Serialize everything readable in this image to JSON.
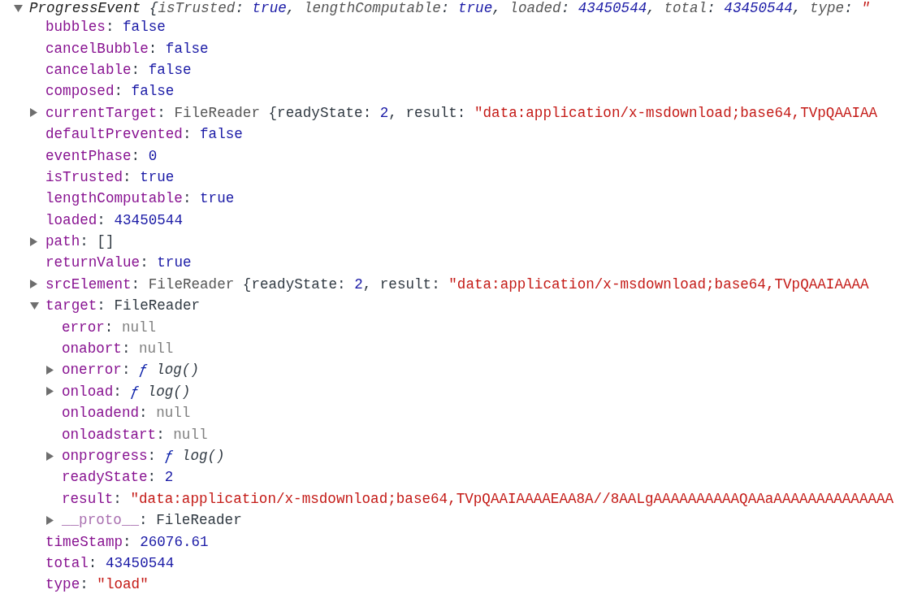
{
  "root": {
    "kind": "expandable",
    "expanded": true,
    "tokens": [
      {
        "text": "ProgressEvent",
        "kind": "class"
      },
      {
        "text": " {",
        "kind": "punct"
      },
      {
        "text": "isTrusted",
        "kind": "pkey"
      },
      {
        "text": ": ",
        "kind": "punct"
      },
      {
        "text": "true",
        "kind": "boolean"
      },
      {
        "text": ", ",
        "kind": "punct"
      },
      {
        "text": "lengthComputable",
        "kind": "pkey"
      },
      {
        "text": ": ",
        "kind": "punct"
      },
      {
        "text": "true",
        "kind": "boolean"
      },
      {
        "text": ", ",
        "kind": "punct"
      },
      {
        "text": "loaded",
        "kind": "pkey"
      },
      {
        "text": ": ",
        "kind": "punct"
      },
      {
        "text": "43450544",
        "kind": "number"
      },
      {
        "text": ", ",
        "kind": "punct"
      },
      {
        "text": "total",
        "kind": "pkey"
      },
      {
        "text": ": ",
        "kind": "punct"
      },
      {
        "text": "43450544",
        "kind": "number"
      },
      {
        "text": ", ",
        "kind": "punct"
      },
      {
        "text": "type",
        "kind": "pkey"
      },
      {
        "text": ": ",
        "kind": "punct"
      },
      {
        "text": "\"",
        "kind": "string"
      }
    ],
    "children": [
      {
        "kind": "leaf",
        "tokens": [
          {
            "text": "bubbles",
            "kind": "key"
          },
          {
            "text": ": ",
            "kind": "punct"
          },
          {
            "text": "false",
            "kind": "boolean"
          }
        ]
      },
      {
        "kind": "leaf",
        "tokens": [
          {
            "text": "cancelBubble",
            "kind": "key"
          },
          {
            "text": ": ",
            "kind": "punct"
          },
          {
            "text": "false",
            "kind": "boolean"
          }
        ]
      },
      {
        "kind": "leaf",
        "tokens": [
          {
            "text": "cancelable",
            "kind": "key"
          },
          {
            "text": ": ",
            "kind": "punct"
          },
          {
            "text": "false",
            "kind": "boolean"
          }
        ]
      },
      {
        "kind": "leaf",
        "tokens": [
          {
            "text": "composed",
            "kind": "key"
          },
          {
            "text": ": ",
            "kind": "punct"
          },
          {
            "text": "false",
            "kind": "boolean"
          }
        ]
      },
      {
        "kind": "expandable",
        "expanded": false,
        "tokens": [
          {
            "text": "currentTarget",
            "kind": "key"
          },
          {
            "text": ": ",
            "kind": "punct"
          },
          {
            "text": "FileReader",
            "kind": "object"
          },
          {
            "text": " {readyState: ",
            "kind": "punct"
          },
          {
            "text": "2",
            "kind": "number"
          },
          {
            "text": ", result: ",
            "kind": "punct"
          },
          {
            "text": "\"data:application/x-msdownload;base64,TVpQAAIAA",
            "kind": "string"
          }
        ]
      },
      {
        "kind": "leaf",
        "tokens": [
          {
            "text": "defaultPrevented",
            "kind": "key"
          },
          {
            "text": ": ",
            "kind": "punct"
          },
          {
            "text": "false",
            "kind": "boolean"
          }
        ]
      },
      {
        "kind": "leaf",
        "tokens": [
          {
            "text": "eventPhase",
            "kind": "key"
          },
          {
            "text": ": ",
            "kind": "punct"
          },
          {
            "text": "0",
            "kind": "number"
          }
        ]
      },
      {
        "kind": "leaf",
        "tokens": [
          {
            "text": "isTrusted",
            "kind": "key"
          },
          {
            "text": ": ",
            "kind": "punct"
          },
          {
            "text": "true",
            "kind": "boolean"
          }
        ]
      },
      {
        "kind": "leaf",
        "tokens": [
          {
            "text": "lengthComputable",
            "kind": "key"
          },
          {
            "text": ": ",
            "kind": "punct"
          },
          {
            "text": "true",
            "kind": "boolean"
          }
        ]
      },
      {
        "kind": "leaf",
        "tokens": [
          {
            "text": "loaded",
            "kind": "key"
          },
          {
            "text": ": ",
            "kind": "punct"
          },
          {
            "text": "43450544",
            "kind": "number"
          }
        ]
      },
      {
        "kind": "expandable",
        "expanded": false,
        "tokens": [
          {
            "text": "path",
            "kind": "key"
          },
          {
            "text": ": ",
            "kind": "punct"
          },
          {
            "text": "[]",
            "kind": "punct"
          }
        ]
      },
      {
        "kind": "leaf",
        "tokens": [
          {
            "text": "returnValue",
            "kind": "key"
          },
          {
            "text": ": ",
            "kind": "punct"
          },
          {
            "text": "true",
            "kind": "boolean"
          }
        ]
      },
      {
        "kind": "expandable",
        "expanded": false,
        "tokens": [
          {
            "text": "srcElement",
            "kind": "key"
          },
          {
            "text": ": ",
            "kind": "punct"
          },
          {
            "text": "FileReader",
            "kind": "object"
          },
          {
            "text": " {readyState: ",
            "kind": "punct"
          },
          {
            "text": "2",
            "kind": "number"
          },
          {
            "text": ", result: ",
            "kind": "punct"
          },
          {
            "text": "\"data:application/x-msdownload;base64,TVpQAAIAAAA",
            "kind": "string"
          }
        ]
      },
      {
        "kind": "expandable",
        "expanded": true,
        "tokens": [
          {
            "text": "target",
            "kind": "key"
          },
          {
            "text": ": ",
            "kind": "punct"
          },
          {
            "text": "FileReader",
            "kind": "punct"
          }
        ],
        "children": [
          {
            "kind": "leaf",
            "tokens": [
              {
                "text": "error",
                "kind": "key"
              },
              {
                "text": ": ",
                "kind": "punct"
              },
              {
                "text": "null",
                "kind": "null"
              }
            ]
          },
          {
            "kind": "leaf",
            "tokens": [
              {
                "text": "onabort",
                "kind": "key"
              },
              {
                "text": ": ",
                "kind": "punct"
              },
              {
                "text": "null",
                "kind": "null"
              }
            ]
          },
          {
            "kind": "expandable",
            "expanded": false,
            "tokens": [
              {
                "text": "onerror",
                "kind": "key"
              },
              {
                "text": ": ",
                "kind": "punct"
              },
              {
                "text": "ƒ",
                "kind": "function"
              },
              {
                "text": " log()",
                "kind": "fname"
              }
            ]
          },
          {
            "kind": "expandable",
            "expanded": false,
            "tokens": [
              {
                "text": "onload",
                "kind": "key"
              },
              {
                "text": ": ",
                "kind": "punct"
              },
              {
                "text": "ƒ",
                "kind": "function"
              },
              {
                "text": " log()",
                "kind": "fname"
              }
            ]
          },
          {
            "kind": "leaf",
            "tokens": [
              {
                "text": "onloadend",
                "kind": "key"
              },
              {
                "text": ": ",
                "kind": "punct"
              },
              {
                "text": "null",
                "kind": "null"
              }
            ]
          },
          {
            "kind": "leaf",
            "tokens": [
              {
                "text": "onloadstart",
                "kind": "key"
              },
              {
                "text": ": ",
                "kind": "punct"
              },
              {
                "text": "null",
                "kind": "null"
              }
            ]
          },
          {
            "kind": "expandable",
            "expanded": false,
            "tokens": [
              {
                "text": "onprogress",
                "kind": "key"
              },
              {
                "text": ": ",
                "kind": "punct"
              },
              {
                "text": "ƒ",
                "kind": "function"
              },
              {
                "text": " log()",
                "kind": "fname"
              }
            ]
          },
          {
            "kind": "leaf",
            "tokens": [
              {
                "text": "readyState",
                "kind": "key"
              },
              {
                "text": ": ",
                "kind": "punct"
              },
              {
                "text": "2",
                "kind": "number"
              }
            ]
          },
          {
            "kind": "leaf",
            "tokens": [
              {
                "text": "result",
                "kind": "key"
              },
              {
                "text": ": ",
                "kind": "punct"
              },
              {
                "text": "\"data:application/x-msdownload;base64,TVpQAAIAAAAEAA8A//8AALgAAAAAAAAAAQAAaAAAAAAAAAAAAAA",
                "kind": "string"
              }
            ]
          },
          {
            "kind": "expandable",
            "expanded": false,
            "tokens": [
              {
                "text": "__proto__",
                "kind": "protokey"
              },
              {
                "text": ": ",
                "kind": "punct"
              },
              {
                "text": "FileReader",
                "kind": "punct"
              }
            ]
          }
        ]
      },
      {
        "kind": "leaf",
        "tokens": [
          {
            "text": "timeStamp",
            "kind": "key"
          },
          {
            "text": ": ",
            "kind": "punct"
          },
          {
            "text": "26076.61",
            "kind": "number"
          }
        ]
      },
      {
        "kind": "leaf",
        "tokens": [
          {
            "text": "total",
            "kind": "key"
          },
          {
            "text": ": ",
            "kind": "punct"
          },
          {
            "text": "43450544",
            "kind": "number"
          }
        ]
      },
      {
        "kind": "leaf",
        "tokens": [
          {
            "text": "type",
            "kind": "key"
          },
          {
            "text": ": ",
            "kind": "punct"
          },
          {
            "text": "\"load\"",
            "kind": "string"
          }
        ]
      }
    ]
  }
}
